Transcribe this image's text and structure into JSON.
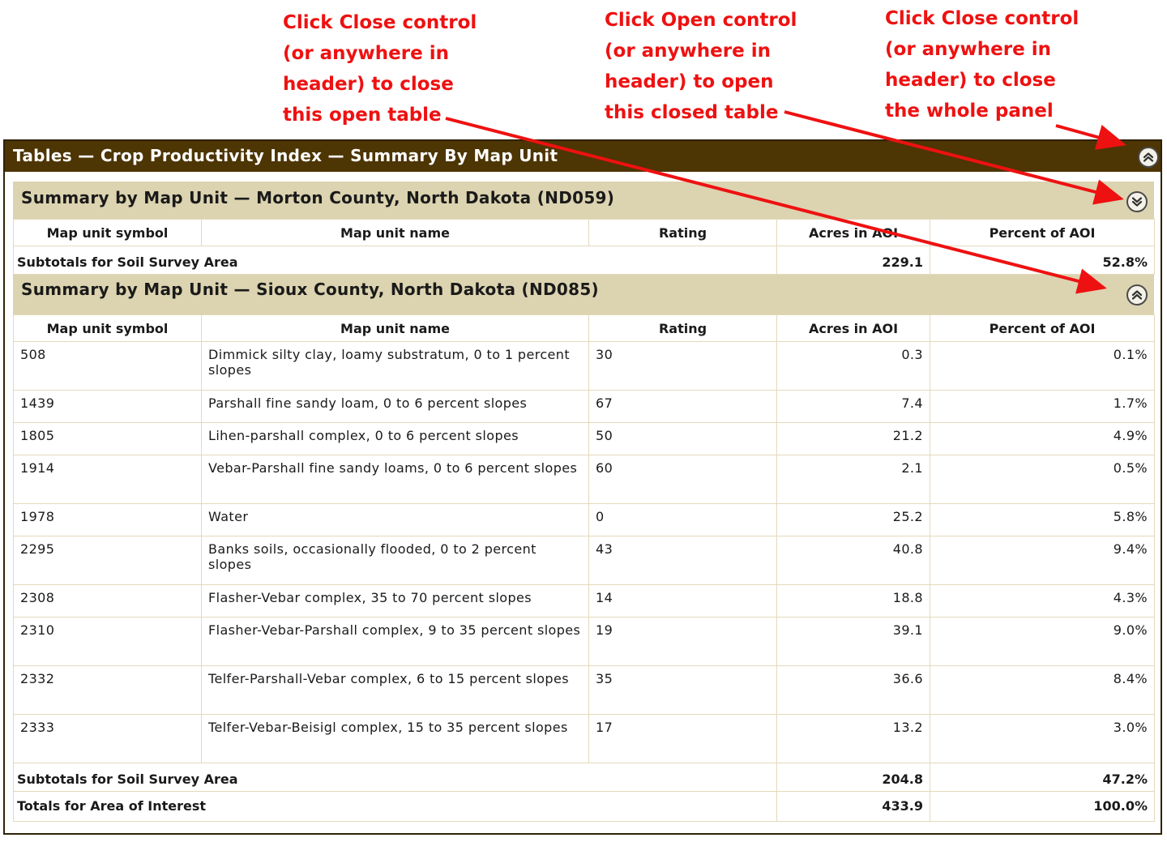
{
  "annotations": [
    {
      "lines": [
        "Click Close control",
        "(or anywhere in",
        "header) to close",
        "this open table"
      ]
    },
    {
      "lines": [
        "Click Open control",
        "(or anywhere in",
        "header) to open",
        "this closed table"
      ]
    },
    {
      "lines": [
        "Click Close control",
        "(or anywhere in",
        "header) to close",
        "the whole panel"
      ]
    }
  ],
  "colors": {
    "panel_header": "#4d3504",
    "section_header": "#dcd3b0",
    "annotation": "#ee1111"
  },
  "panel": {
    "title": "Tables — Crop Productivity Index — Summary By Map Unit",
    "toggle_icon": "collapse-up-icon"
  },
  "columns": [
    "Map unit symbol",
    "Map unit name",
    "Rating",
    "Acres in AOI",
    "Percent of AOI"
  ],
  "morton": {
    "title": "Summary by Map Unit — Morton County, North Dakota (ND059)",
    "toggle_icon": "expand-down-icon",
    "subtotal": {
      "label": "Subtotals for Soil Survey Area",
      "acres": "229.1",
      "percent": "52.8%"
    }
  },
  "sioux": {
    "title": "Summary by Map Unit — Sioux County, North Dakota (ND085)",
    "toggle_icon": "collapse-up-icon",
    "rows": [
      {
        "symbol": "508",
        "name": "Dimmick silty clay, loamy substratum, 0 to 1 percent slopes",
        "rating": "30",
        "acres": "0.3",
        "percent": "0.1%"
      },
      {
        "symbol": "1439",
        "name": "Parshall fine sandy loam, 0 to 6 percent slopes",
        "rating": "67",
        "acres": "7.4",
        "percent": "1.7%"
      },
      {
        "symbol": "1805",
        "name": "Lihen-parshall complex, 0 to 6 percent slopes",
        "rating": "50",
        "acres": "21.2",
        "percent": "4.9%"
      },
      {
        "symbol": "1914",
        "name": "Vebar-Parshall fine sandy loams, 0 to 6 percent slopes",
        "rating": "60",
        "acres": "2.1",
        "percent": "0.5%"
      },
      {
        "symbol": "1978",
        "name": "Water",
        "rating": "0",
        "acres": "25.2",
        "percent": "5.8%"
      },
      {
        "symbol": "2295",
        "name": "Banks soils, occasionally flooded, 0 to 2 percent slopes",
        "rating": "43",
        "acres": "40.8",
        "percent": "9.4%"
      },
      {
        "symbol": "2308",
        "name": "Flasher-Vebar complex, 35 to 70 percent slopes",
        "rating": "14",
        "acres": "18.8",
        "percent": "4.3%"
      },
      {
        "symbol": "2310",
        "name": "Flasher-Vebar-Parshall complex, 9 to 35 percent slopes",
        "rating": "19",
        "acres": "39.1",
        "percent": "9.0%"
      },
      {
        "symbol": "2332",
        "name": "Telfer-Parshall-Vebar complex, 6 to 15 percent slopes",
        "rating": "35",
        "acres": "36.6",
        "percent": "8.4%"
      },
      {
        "symbol": "2333",
        "name": "Telfer-Vebar-Beisigl complex, 15 to 35 percent slopes",
        "rating": "17",
        "acres": "13.2",
        "percent": "3.0%"
      }
    ],
    "subtotal": {
      "label": "Subtotals for Soil Survey Area",
      "acres": "204.8",
      "percent": "47.2%"
    },
    "total": {
      "label": "Totals for Area of Interest",
      "acres": "433.9",
      "percent": "100.0%"
    }
  }
}
